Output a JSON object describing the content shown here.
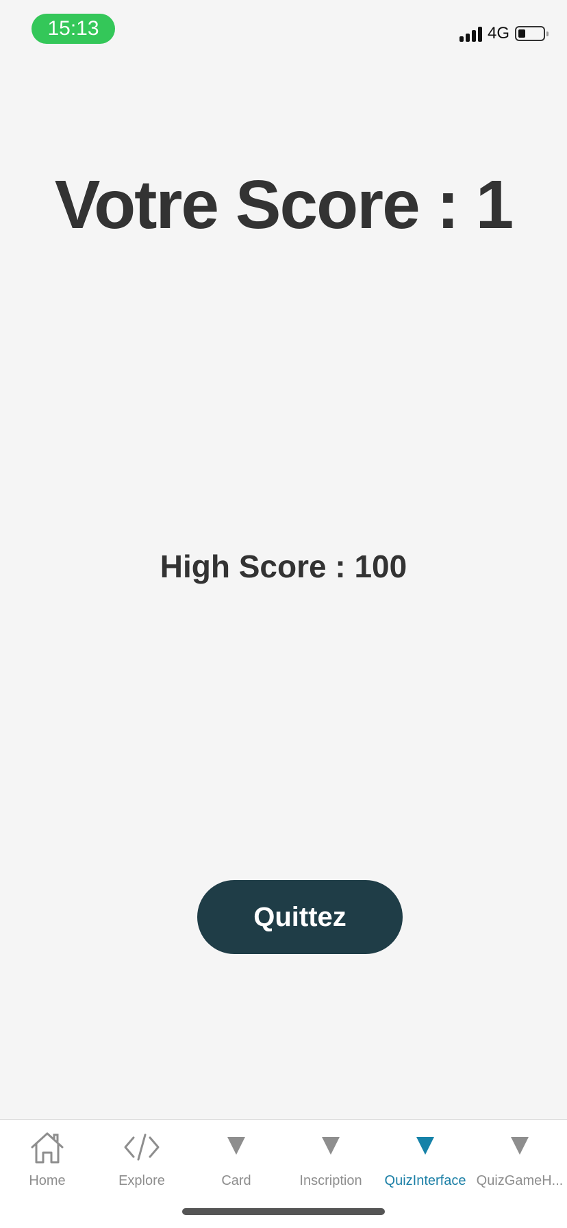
{
  "status_bar": {
    "time": "15:13",
    "network": "4G"
  },
  "main": {
    "score_title": "Votre Score : 1",
    "high_score": "High Score : 100",
    "quit_label": "Quittez"
  },
  "tab_bar": {
    "tabs": [
      {
        "label": "Home",
        "icon": "home-icon",
        "active": false
      },
      {
        "label": "Explore",
        "icon": "code-icon",
        "active": false
      },
      {
        "label": "Card",
        "icon": "triangle-icon",
        "active": false
      },
      {
        "label": "Inscription",
        "icon": "triangle-icon",
        "active": false
      },
      {
        "label": "QuizInterface",
        "icon": "triangle-icon",
        "active": true
      },
      {
        "label": "QuizGameH...",
        "icon": "triangle-icon",
        "active": false
      }
    ]
  },
  "colors": {
    "background": "#f5f5f5",
    "time_pill": "#34c759",
    "button": "#1f3d47",
    "active_tab": "#1b7fa6",
    "inactive_tab": "#8e8e8e"
  }
}
